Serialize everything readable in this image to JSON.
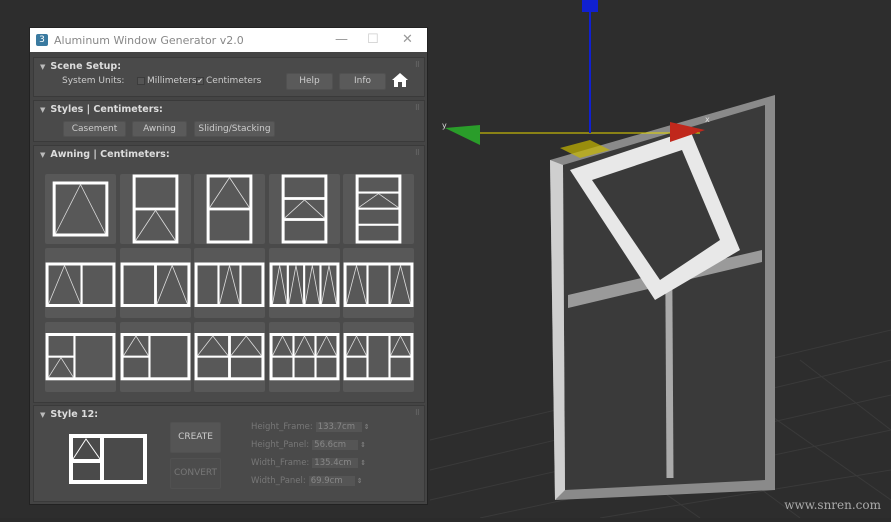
{
  "window": {
    "title": "Aluminum Window Generator v2.0",
    "app_icon": "3"
  },
  "scene_setup": {
    "title": "Scene Setup:",
    "system_units_label": "System Units:",
    "millimeters_label": "Millimeters",
    "millimeters_checked": false,
    "centimeters_label": "Centimeters",
    "centimeters_checked": true,
    "help_label": "Help",
    "info_label": "Info",
    "check_mark": "✔"
  },
  "styles": {
    "title": "Styles | Centimeters:",
    "buttons": [
      "Casement",
      "Awning",
      "Sliding/Stacking"
    ]
  },
  "awning": {
    "title": "Awning | Centimeters:"
  },
  "style_detail": {
    "title": "Style 12:",
    "create_label": "CREATE",
    "convert_label": "CONVERT",
    "fields": [
      {
        "label": "Height_Frame:",
        "value": "133.7cm"
      },
      {
        "label": "Height_Panel:",
        "value": "56.6cm"
      },
      {
        "label": "Width_Frame:",
        "value": "135.4cm"
      },
      {
        "label": "Width_Panel:",
        "value": "69.9cm"
      }
    ]
  },
  "watermark": "www.snren.com",
  "colors": {
    "axis_x": "#c0281c",
    "axis_y": "#2a9d2a",
    "axis_z": "#1020d0",
    "gizmo_line": "#e6d800"
  }
}
